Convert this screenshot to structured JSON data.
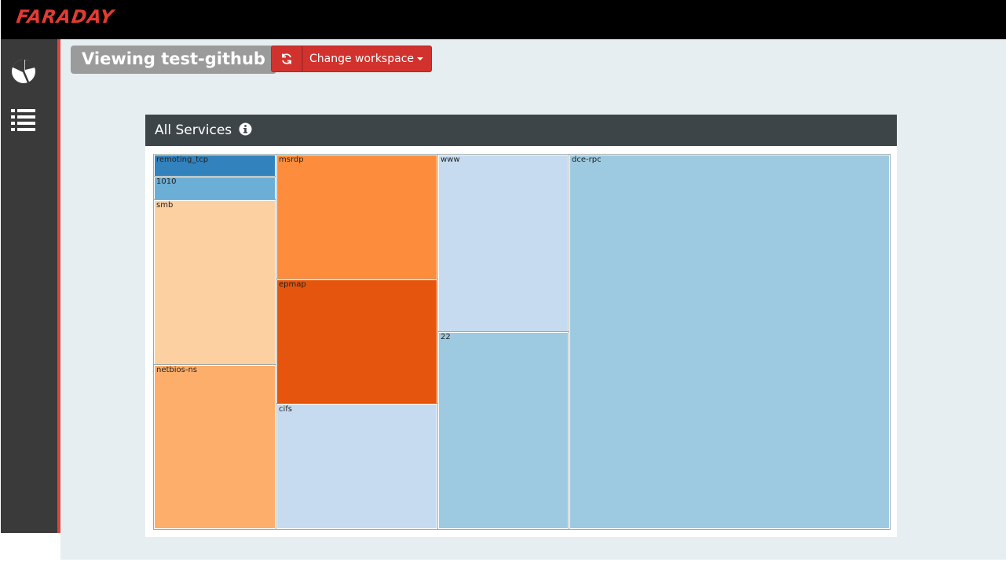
{
  "header": {
    "logo_text": "FARADAY"
  },
  "sidebar": {
    "items": [
      {
        "name": "dashboard",
        "icon": "pie-chart-icon"
      },
      {
        "name": "status-report",
        "icon": "list-icon"
      }
    ],
    "accent_color": "#d9463f"
  },
  "workspace": {
    "label": "Viewing test-github",
    "refresh_icon": "refresh-icon",
    "change_label": "Change workspace"
  },
  "panel": {
    "title": "All Services",
    "info_icon": "info-icon"
  },
  "treemap": {
    "services": [
      {
        "name": "remoting_tcp",
        "color": "#3182bd"
      },
      {
        "name": "1010",
        "color": "#6baed6"
      },
      {
        "name": "smb",
        "color": "#fdd0a2"
      },
      {
        "name": "netbios-ns",
        "color": "#fdae6b"
      },
      {
        "name": "msrdp",
        "color": "#fd8d3c"
      },
      {
        "name": "epmap",
        "color": "#e6550d"
      },
      {
        "name": "cifs",
        "color": "#c6dbef"
      },
      {
        "name": "www",
        "color": "#c6dbef"
      },
      {
        "name": "22",
        "color": "#9ecae1"
      },
      {
        "name": "dce-rpc",
        "color": "#9ecae1"
      }
    ]
  }
}
